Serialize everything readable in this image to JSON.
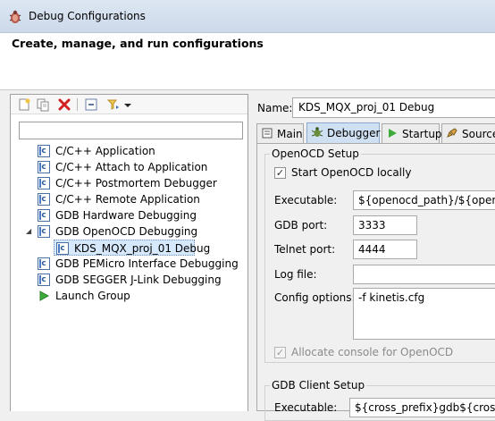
{
  "window": {
    "title": "Debug Configurations",
    "icon": "debug-bug-icon"
  },
  "header": {
    "title": "Create, manage, and run configurations"
  },
  "left": {
    "toolbar": {
      "buttons": [
        "new-configuration-icon",
        "duplicate-icon",
        "delete-icon",
        "collapse-all-icon",
        "filter-icon",
        "dropdown-arrow-icon"
      ]
    },
    "filter": {
      "value": "",
      "placeholder": ""
    },
    "tree": [
      {
        "label": "C/C++ Application",
        "icon": "c-config-icon"
      },
      {
        "label": "C/C++ Attach to Application",
        "icon": "c-config-icon"
      },
      {
        "label": "C/C++ Postmortem Debugger",
        "icon": "c-config-icon"
      },
      {
        "label": "C/C++ Remote Application",
        "icon": "c-config-icon"
      },
      {
        "label": "GDB Hardware Debugging",
        "icon": "c-config-icon"
      },
      {
        "label": "GDB OpenOCD Debugging",
        "icon": "c-config-icon",
        "expanded": true
      },
      {
        "label": "KDS_MQX_proj_01 Debug",
        "icon": "c-config-icon",
        "selected": true
      },
      {
        "label": "GDB PEMicro Interface Debugging",
        "icon": "c-config-icon"
      },
      {
        "label": "GDB SEGGER J-Link Debugging",
        "icon": "c-config-icon"
      },
      {
        "label": "Launch Group",
        "icon": "green-launch-icon"
      }
    ]
  },
  "right": {
    "name_label": "Name:",
    "name_value": "KDS_MQX_proj_01 Debug",
    "tabs": [
      {
        "label": "Main",
        "icon": "main-tab-icon"
      },
      {
        "label": "Debugger",
        "icon": "debugger-bug-icon",
        "active": true
      },
      {
        "label": "Startup",
        "icon": "startup-run-icon"
      },
      {
        "label": "Source",
        "icon": "source-icon"
      }
    ],
    "openocd": {
      "group_title": "OpenOCD Setup",
      "start_locally_label": "Start OpenOCD locally",
      "start_locally_checked": true,
      "executable_label": "Executable:",
      "executable_value": "${openocd_path}/${openocd_",
      "gdb_port_label": "GDB port:",
      "gdb_port_value": "3333",
      "telnet_port_label": "Telnet port:",
      "telnet_port_value": "4444",
      "log_file_label": "Log file:",
      "log_file_value": "",
      "config_options_label": "Config options:",
      "config_options_value": "-f kinetis.cfg",
      "allocate_console_label": "Allocate console for OpenOCD",
      "allocate_console_checked": true
    },
    "gdb_client": {
      "group_title": "GDB Client Setup",
      "executable_label": "Executable:",
      "executable_value": "${cross_prefix}gdb${cross_suffi"
    }
  },
  "colors": {
    "titlebar": "#d5e0ee",
    "selection": "#d6e8fb",
    "active_tab": "#cfe0f2"
  }
}
